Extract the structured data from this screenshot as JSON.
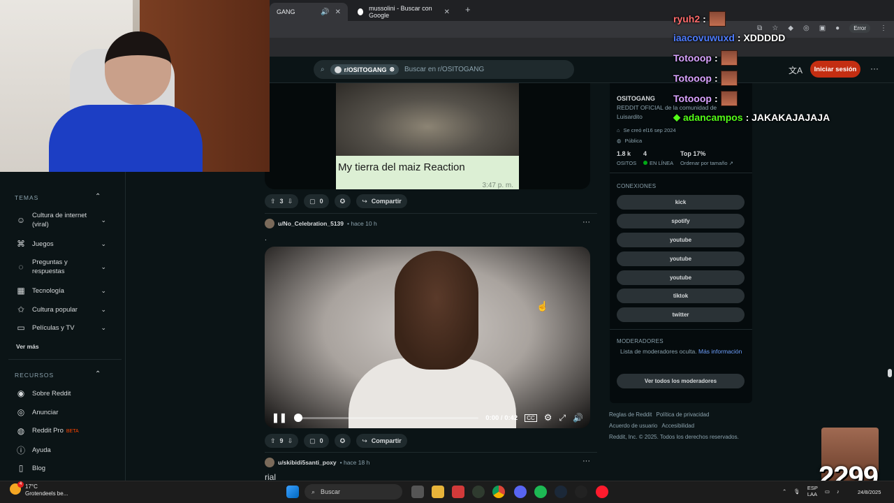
{
  "browser": {
    "tabs": [
      {
        "label": "GANG",
        "muted_icon": "speaker-icon"
      },
      {
        "label": "mussolini - Buscar con Google"
      }
    ],
    "new_tab": "+",
    "error_label": "Error"
  },
  "reddit": {
    "search_chip": "r/OSITOGANG",
    "search_placeholder": "Buscar en r/OSITOGANG",
    "login": "Iniciar sesión"
  },
  "sidebar": {
    "temas_header": "TEMAS",
    "temas": [
      {
        "label": "Cultura de internet (viral)",
        "icon": "smile-icon"
      },
      {
        "label": "Juegos",
        "icon": "gamepad-icon"
      },
      {
        "label": "Preguntas y respuestas",
        "icon": "question-icon"
      },
      {
        "label": "Tecnología",
        "icon": "chip-icon"
      },
      {
        "label": "Cultura popular",
        "icon": "star-icon"
      },
      {
        "label": "Películas y TV",
        "icon": "film-icon"
      }
    ],
    "ver_mas": "Ver más",
    "recursos_header": "RECURSOS",
    "recursos": [
      {
        "label": "Sobre Reddit",
        "icon": "reddit-icon"
      },
      {
        "label": "Anunciar",
        "icon": "megaphone-icon"
      },
      {
        "label": "Reddit Pro",
        "icon": "pro-icon",
        "badge": "BETA"
      },
      {
        "label": "Ayuda",
        "icon": "help-icon"
      },
      {
        "label": "Blog",
        "icon": "book-icon"
      }
    ]
  },
  "feed": {
    "post1": {
      "caption": "My tierra del maiz Reaction",
      "caption_time": "3:47 p. m.",
      "votes": "3",
      "comments": "0",
      "share": "Compartir"
    },
    "post2": {
      "author": "u/No_Celebration_5139",
      "age": "• hace 10 h",
      "body": ".",
      "video_time": "0:00 / 0:42",
      "votes": "9",
      "comments": "0",
      "share": "Compartir"
    },
    "post3": {
      "author": "u/skibidi5santi_poxy",
      "age": "• hace 18 h",
      "title": "rial"
    }
  },
  "community": {
    "name": "OSITOGANG",
    "description": "REDDIT OFICIAL de la comunidad de Luisardito",
    "created": "Se creó el16 sep 2024",
    "visibility": "Pública",
    "members_count": "1.8 k",
    "members_label": "OSITOS",
    "online_count": "4",
    "online_label": "EN LÍNEA",
    "rank": "Top 17%",
    "rank_label": "Ordenar por tamaño",
    "connections_header": "CONEXIONES",
    "connections": [
      "kick",
      "spotify",
      "youtube",
      "youtube",
      "youtube",
      "tiktok",
      "twitter"
    ],
    "mods_header": "MODERADORES",
    "mods_text": "Lista de moderadores oculta.",
    "mods_link": "Más información",
    "mods_button": "Ver todos los moderadores",
    "footer": [
      "Reglas de Reddit",
      "Política de privacidad",
      "Acuerdo de usuario",
      "Accesibilidad",
      "Reddit, Inc. © 2025. Todos los derechos reservados."
    ]
  },
  "chat": [
    {
      "user": "ryuh2",
      "color": "#ff6b6b",
      "msg": ":",
      "emote": true
    },
    {
      "user": "iaacovuwuxd",
      "color": "#4d7cff",
      "msg": ": XDDDDD",
      "emote": false
    },
    {
      "user": "Totooop",
      "color": "#d9a3ff",
      "msg": ":",
      "emote": true
    },
    {
      "user": "Totooop",
      "color": "#d9a3ff",
      "msg": ":",
      "emote": true
    },
    {
      "user": "Totooop",
      "color": "#d9a3ff",
      "msg": ":",
      "emote": true
    },
    {
      "user": "adancampos",
      "color": "#53fc18",
      "msg": ": JAKAKAJAJAJA",
      "emote": false
    }
  ],
  "overlay": {
    "count": "2299"
  },
  "taskbar": {
    "weather_temp": "17°C",
    "weather_desc": "Grotendeels be...",
    "weather_badge": "4",
    "search": "Buscar",
    "lang": "ESP",
    "lang2": "LAA",
    "date": "24/8/2025"
  }
}
